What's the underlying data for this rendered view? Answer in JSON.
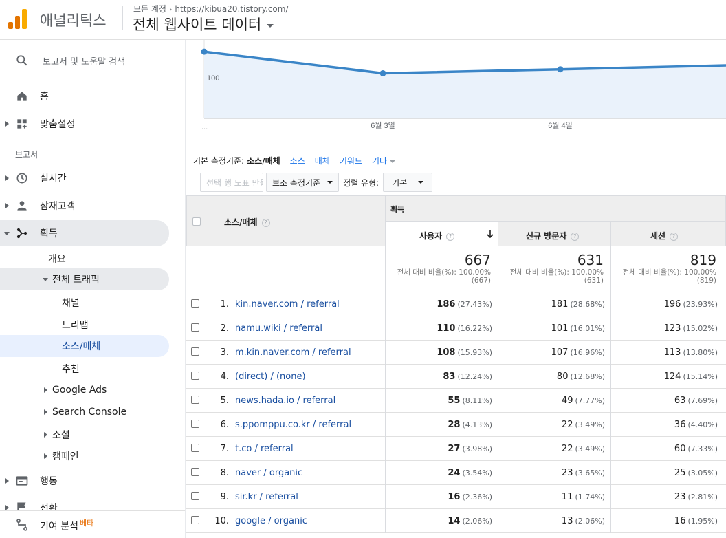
{
  "header": {
    "app_name": "애널리틱스",
    "breadcrumb_account": "모든 계정",
    "breadcrumb_url": "https://kibua20.tistory.com/",
    "property": "전체 웹사이트 데이터",
    "logo_colors": [
      "#f9ab00",
      "#e37400",
      "#e37400"
    ]
  },
  "sidebar": {
    "search_placeholder": "보고서 및 도움말 검색",
    "home": "홈",
    "customization": "맞춤설정",
    "reports_section": "보고서",
    "realtime": "실시간",
    "audience": "잠재고객",
    "acquisition": "획득",
    "acq_overview": "개요",
    "all_traffic": "전체 트래픽",
    "channels": "채널",
    "treemap": "트리맵",
    "source_medium": "소스/매체",
    "referrals": "추천",
    "google_ads": "Google Ads",
    "search_console": "Search Console",
    "social": "소셜",
    "campaigns": "캠페인",
    "behavior": "행동",
    "conversions": "전환",
    "attribution": "기여 분석",
    "beta": "베타"
  },
  "chart": {
    "y_tick": "100",
    "x_labels": [
      "...",
      "6월 3일",
      "6월 4일"
    ],
    "points": [
      114,
      103,
      105,
      107
    ],
    "ylim": [
      80,
      120
    ],
    "color": "#3a85c7"
  },
  "dimension_bar": {
    "label": "기본 측정기준:",
    "current": "소스/매체",
    "options": [
      "소스",
      "매체",
      "키워드"
    ],
    "more": "기타"
  },
  "toolbar": {
    "plot_rows": "선택 행 도표 만들기",
    "secondary_dim": "보조 측정기준",
    "sort_label": "정렬 유형:",
    "sort_value": "기본"
  },
  "table": {
    "col_dimension": "소스/매체",
    "group_acquisition": "획득",
    "col_users": "사용자",
    "col_new_users": "신규 방문자",
    "col_sessions": "세션",
    "help": "?",
    "totals": {
      "users": "667",
      "users_pct": "전체 대비 비율(%): 100.00%",
      "users_of": "(667)",
      "new_users": "631",
      "new_users_pct": "전체 대비 비율(%): 100.00%",
      "new_users_of": "(631)",
      "sessions": "819",
      "sessions_pct": "전체 대비 비율(%): 100.00%",
      "sessions_of": "(819)"
    },
    "rows": [
      {
        "n": "1.",
        "source": "kin.naver.com / referral",
        "users": "186",
        "users_pct": "(27.43%)",
        "new": "181",
        "new_pct": "(28.68%)",
        "sessions": "196",
        "sessions_pct": "(23.93%)"
      },
      {
        "n": "2.",
        "source": "namu.wiki / referral",
        "users": "110",
        "users_pct": "(16.22%)",
        "new": "101",
        "new_pct": "(16.01%)",
        "sessions": "123",
        "sessions_pct": "(15.02%)"
      },
      {
        "n": "3.",
        "source": "m.kin.naver.com / referral",
        "users": "108",
        "users_pct": "(15.93%)",
        "new": "107",
        "new_pct": "(16.96%)",
        "sessions": "113",
        "sessions_pct": "(13.80%)"
      },
      {
        "n": "4.",
        "source": "(direct) / (none)",
        "users": "83",
        "users_pct": "(12.24%)",
        "new": "80",
        "new_pct": "(12.68%)",
        "sessions": "124",
        "sessions_pct": "(15.14%)"
      },
      {
        "n": "5.",
        "source": "news.hada.io / referral",
        "users": "55",
        "users_pct": "(8.11%)",
        "new": "49",
        "new_pct": "(7.77%)",
        "sessions": "63",
        "sessions_pct": "(7.69%)"
      },
      {
        "n": "6.",
        "source": "s.ppomppu.co.kr / referral",
        "users": "28",
        "users_pct": "(4.13%)",
        "new": "22",
        "new_pct": "(3.49%)",
        "sessions": "36",
        "sessions_pct": "(4.40%)"
      },
      {
        "n": "7.",
        "source": "t.co / referral",
        "users": "27",
        "users_pct": "(3.98%)",
        "new": "22",
        "new_pct": "(3.49%)",
        "sessions": "60",
        "sessions_pct": "(7.33%)"
      },
      {
        "n": "8.",
        "source": "naver / organic",
        "users": "24",
        "users_pct": "(3.54%)",
        "new": "23",
        "new_pct": "(3.65%)",
        "sessions": "25",
        "sessions_pct": "(3.05%)"
      },
      {
        "n": "9.",
        "source": "sir.kr / referral",
        "users": "16",
        "users_pct": "(2.36%)",
        "new": "11",
        "new_pct": "(1.74%)",
        "sessions": "23",
        "sessions_pct": "(2.81%)"
      },
      {
        "n": "10.",
        "source": "google / organic",
        "users": "14",
        "users_pct": "(2.06%)",
        "new": "13",
        "new_pct": "(2.06%)",
        "sessions": "16",
        "sessions_pct": "(1.95%)"
      }
    ]
  },
  "accent": "#1a73e8"
}
